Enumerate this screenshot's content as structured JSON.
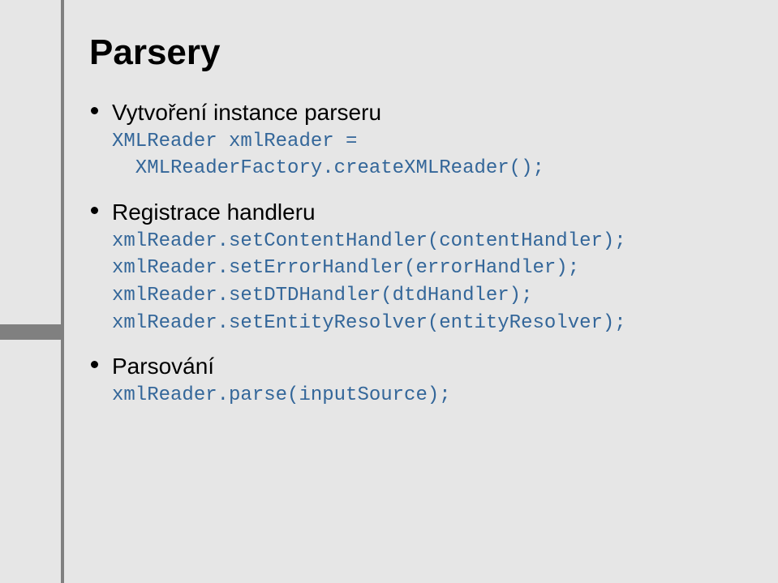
{
  "title": "Parsery",
  "bullets": [
    {
      "label": "Vytvoření instance parseru",
      "code": "XMLReader xmlReader =\n  XMLReaderFactory.createXMLReader();"
    },
    {
      "label": "Registrace handleru",
      "code": "xmlReader.setContentHandler(contentHandler);\nxmlReader.setErrorHandler(errorHandler);\nxmlReader.setDTDHandler(dtdHandler);\nxmlReader.setEntityResolver(entityResolver);"
    },
    {
      "label": "Parsování",
      "code": "xmlReader.parse(inputSource);"
    }
  ]
}
